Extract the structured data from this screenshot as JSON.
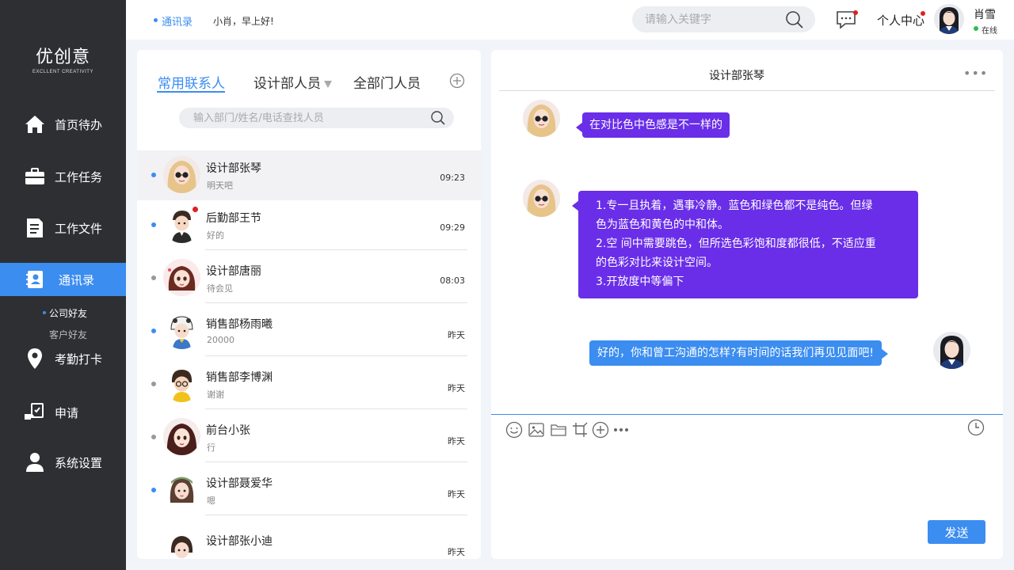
{
  "colors": {
    "sidebar_bg": "#2e2f33",
    "accent": "#3b8df0",
    "purple_bubble": "#6a2ee8",
    "unread": "#e02020",
    "online": "#2dbb4e"
  },
  "sidebar": {
    "logo_cn": "优创意",
    "logo_en": "EXCLLENT CREATIVITY",
    "items": [
      {
        "label": "首页待办",
        "icon": "home-icon"
      },
      {
        "label": "工作任务",
        "icon": "briefcase-icon"
      },
      {
        "label": "工作文件",
        "icon": "document-icon"
      },
      {
        "label": "通讯录",
        "icon": "contacts-book-icon",
        "active": true
      },
      {
        "label": "考勤打卡",
        "icon": "location-pin-icon"
      },
      {
        "label": "申请",
        "icon": "apply-hand-icon"
      },
      {
        "label": "系统设置",
        "icon": "user-settings-icon"
      }
    ],
    "subitems": [
      {
        "label": "公司好友",
        "active": true
      },
      {
        "label": "客户好友"
      }
    ]
  },
  "header": {
    "breadcrumb": "通讯录",
    "greeting": "小肖，早上好!",
    "search_placeholder": "请输入关键字",
    "personal_center": "个人中心",
    "user_name": "肖雪",
    "user_status": "在线"
  },
  "contacts_panel": {
    "tabs": [
      "常用联系人",
      "设计部人员",
      "全部门人员"
    ],
    "search_placeholder": "输入部门/姓名/电话查找人员",
    "contacts": [
      {
        "name": "设计部张琴",
        "message": "明天吧",
        "time": "09:23"
      },
      {
        "name": "后勤部王节",
        "message": "好的",
        "time": "09:29"
      },
      {
        "name": "设计部唐丽",
        "message": "待会见",
        "time": "08:03"
      },
      {
        "name": "销售部杨雨曦",
        "message": "20000",
        "time": "昨天"
      },
      {
        "name": "销售部李博渊",
        "message": "谢谢",
        "time": "昨天"
      },
      {
        "name": "前台小张",
        "message": "行",
        "time": "昨天"
      },
      {
        "name": "设计部聂爱华",
        "message": "嗯",
        "time": "昨天"
      },
      {
        "name": "设计部张小迪",
        "message": "",
        "time": "昨天"
      }
    ]
  },
  "chat": {
    "title": "设计部张琴",
    "more": "•••",
    "messages": [
      {
        "side": "left",
        "lines": [
          "在对比色中色感是不一样的"
        ]
      },
      {
        "side": "left",
        "lines": [
          "1.专一且执着，遇事冷静。蓝色和绿色都不是纯色。但绿",
          "色为蓝色和黄色的中和体。",
          "2.空 间中需要跳色，但所选色彩饱和度都很低，不适应重",
          "的色彩对比来设计空间。",
          "3.开放度中等偏下"
        ]
      },
      {
        "side": "right",
        "lines": [
          "好的，你和曾工沟通的怎样?有时间的话我们再见见面吧!"
        ]
      }
    ],
    "toolbar_icons": [
      "emoji-icon",
      "image-icon",
      "folder-icon",
      "crop-icon",
      "add-circle-icon",
      "more-icon",
      "history-clock-icon"
    ],
    "send_label": "发送"
  }
}
